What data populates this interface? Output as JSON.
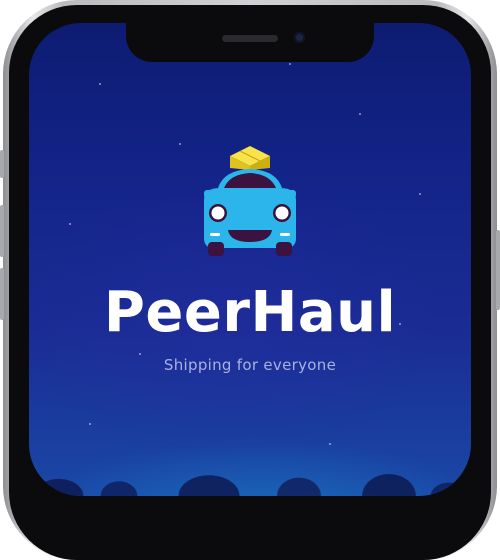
{
  "app": {
    "name": "PeerHaul",
    "tagline": "Shipping for everyone"
  },
  "icons": {
    "logo": "car-with-package-icon"
  },
  "colors": {
    "background_top": "#0d1c72",
    "background_bottom": "#1a48a6",
    "car_body": "#2bb5ea",
    "package": "#f2d72a",
    "title": "#ffffff"
  }
}
